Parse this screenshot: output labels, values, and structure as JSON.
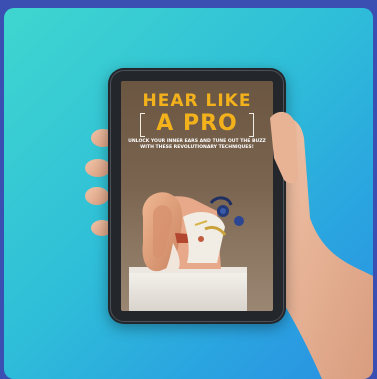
{
  "image": {
    "subject": "hand holding a tablet showing an ebook cover",
    "colors": {
      "frame": "#3b4fb3",
      "background_gradient": [
        "#3fd6cf",
        "#2a8fe2"
      ],
      "tablet_bezel": "#23262b",
      "title_color": "#f3b21b",
      "skin": "#e9b79a"
    }
  },
  "cover": {
    "title_line1": "HEAR LIKE",
    "title_line2": "A PRO",
    "subtitle": "UNLOCK YOUR INNER EARS AND TUNE OUT THE BUZZ WITH THESE REVOLUTIONARY TECHNIQUES!"
  }
}
